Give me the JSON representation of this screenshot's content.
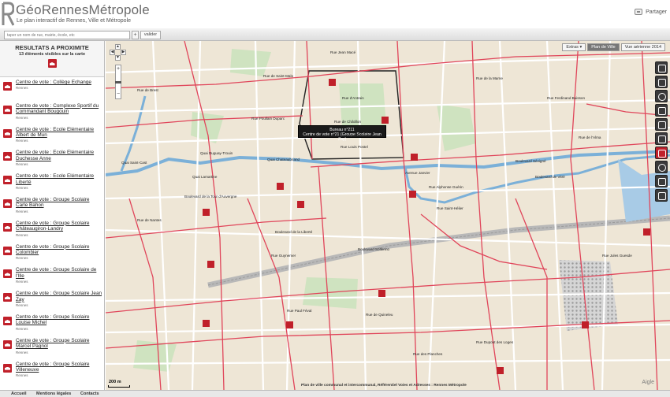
{
  "header": {
    "title": "GéoRennesMétropole",
    "subtitle": "Le plan interactif de Rennes, Ville et Métropole",
    "share_label": "Partager"
  },
  "search": {
    "placeholder": "taper un nom de rue, mairie, école, etc",
    "plus_label": "+",
    "submit_label": "valider"
  },
  "sidebar": {
    "title": "RESULTATS A PROXIMITE",
    "count_text": "13 éléments visibles sur la carte",
    "results": [
      {
        "title": "Centre de vote :  Collège Echange",
        "city": "Rennes"
      },
      {
        "title": "Centre de vote :  Complexe Sportif du Commandant Bougouin",
        "city": "Rennes"
      },
      {
        "title": "Centre de vote :  Ecole Elémentaire Albert de Mun",
        "city": "Rennes"
      },
      {
        "title": "Centre de vote :  Ecole Elémentaire Duchesse Anne",
        "city": "Rennes"
      },
      {
        "title": "Centre de vote :  Ecole Elémentaire Liberté",
        "city": "Rennes"
      },
      {
        "title": "Centre de vote :  Groupe Scolaire Carle Bahon",
        "city": "Rennes"
      },
      {
        "title": "Centre de vote :  Groupe Scolaire Châteaugiron-Landry",
        "city": "Rennes"
      },
      {
        "title": "Centre de vote :  Groupe Scolaire Colombier",
        "city": "Rennes"
      },
      {
        "title": "Centre de vote :  Groupe Scolaire de l'Ille",
        "city": "Rennes"
      },
      {
        "title": "Centre de vote :  Groupe Scolaire Jean Zay",
        "city": "Rennes"
      },
      {
        "title": "Centre de vote :  Groupe Scolaire Louise Michel",
        "city": "Rennes"
      },
      {
        "title": "Centre de vote :  Groupe Scolaire Marcel Pagnol",
        "city": "Rennes"
      },
      {
        "title": "Centre de vote :  Groupe Scolaire Villeneuve",
        "city": "Rennes"
      }
    ]
  },
  "map": {
    "layers": {
      "extras": "Extras",
      "plan": "Plan de Ville",
      "aerial": "Vue aérienne 2014"
    },
    "zoom": {
      "in": "+",
      "out": "−"
    },
    "pan": {
      "up": "▲",
      "down": "▼",
      "left": "◀",
      "right": "▶"
    },
    "tooltip": {
      "line1": "Bureau n°211",
      "line2": "Centre de vote n°21 (Groupe Scolaire Jean Zay)"
    },
    "scale": "200 m",
    "copyright": "Plan de ville communal et intercommunal, Référentiel Voies et Adresses : Rennes Métropole",
    "brand": "Aigle",
    "streets": [
      "Rue Jean Macé",
      "Rue de Brest",
      "Rue d'Antrain",
      "Rue de Saint-Malo",
      "Quai Duguay-Trouin",
      "Quai Lamartine",
      "Quai Chateaubriand",
      "Quai Saint-Cast",
      "Rue de Nantes",
      "Boulevard de la Liberté",
      "Boulevard Solferino",
      "Rue Guynemer",
      "Rue de Quineleu",
      "Rue Paul Féval",
      "Rue de Châtillon",
      "Rue Paul Bert",
      "Rue de la Marne",
      "Rue Alphonse Guérin",
      "Boulevard Sévigné",
      "Boulevard de Vitré",
      "Rue de l'Alma",
      "Rue Ferdinand Buisson",
      "Rue Louis Postel",
      "Rue Poullain Duparc",
      "Avenue Janvier",
      "Rue Saint-Hélier",
      "Boulevard de la Tour d'Auvergne",
      "Rue des Planches",
      "Rue Dupont des Loges",
      "Rue Jules Guesde"
    ],
    "tools": [
      "car-icon",
      "parking-icon",
      "gear-icon",
      "trash-icon",
      "bus-icon",
      "heart-icon",
      "monument-icon",
      "eye-icon",
      "building-icon",
      "home-icon"
    ]
  },
  "footer": {
    "home": "Accueil",
    "legal": "Mentions légales",
    "contacts": "Contacts"
  }
}
